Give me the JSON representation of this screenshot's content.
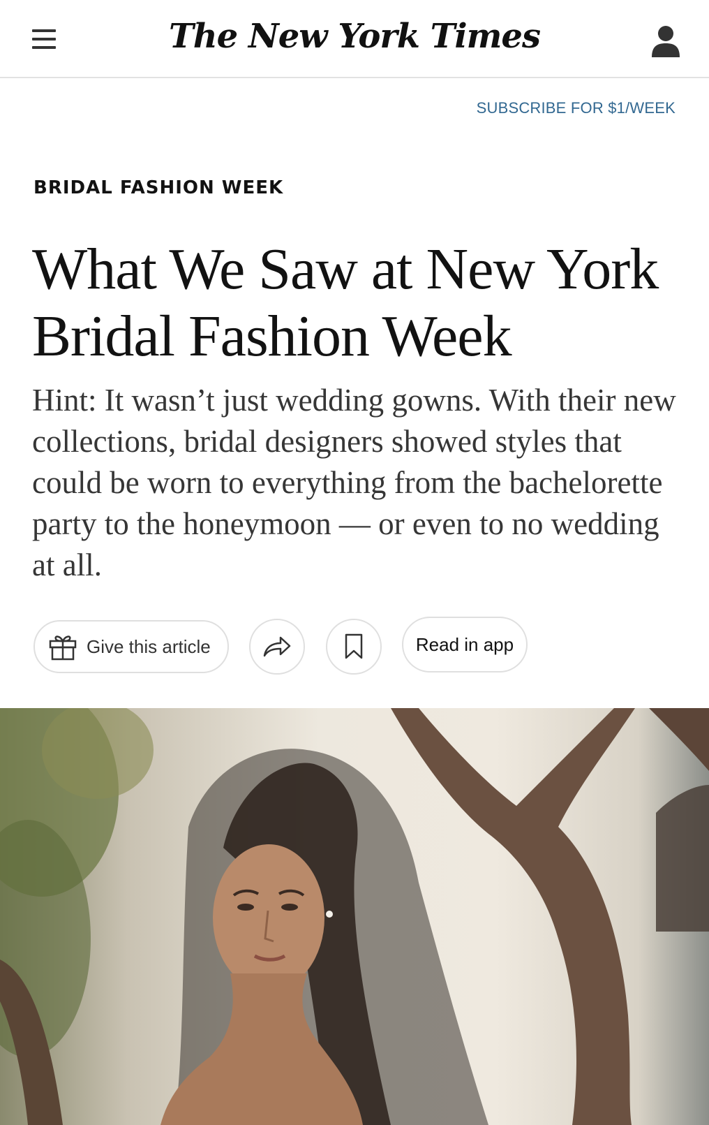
{
  "header": {
    "logo": "The New York Times",
    "menu_icon": "hamburger-menu-icon",
    "account_icon": "account-icon"
  },
  "subscribe": {
    "label": "SUBSCRIBE FOR $1/WEEK"
  },
  "article": {
    "kicker": "BRIDAL FASHION WEEK",
    "headline": "What We Saw at New York Bridal Fashion Week",
    "summary": "Hint: It wasn’t just wedding gowns. With their new collections, bridal designers showed styles that could be worn to everything from the bachelorette party to the honeymoon — or even to no wedding at all."
  },
  "actions": {
    "gift_label": "Give this article",
    "gift_icon": "gift-icon",
    "share_icon": "share-icon",
    "save_icon": "bookmark-icon",
    "app_label": "Read in app"
  },
  "colors": {
    "subscribe": "#326891",
    "text": "#121212",
    "summary": "#363636",
    "border": "#dfdfdf"
  }
}
